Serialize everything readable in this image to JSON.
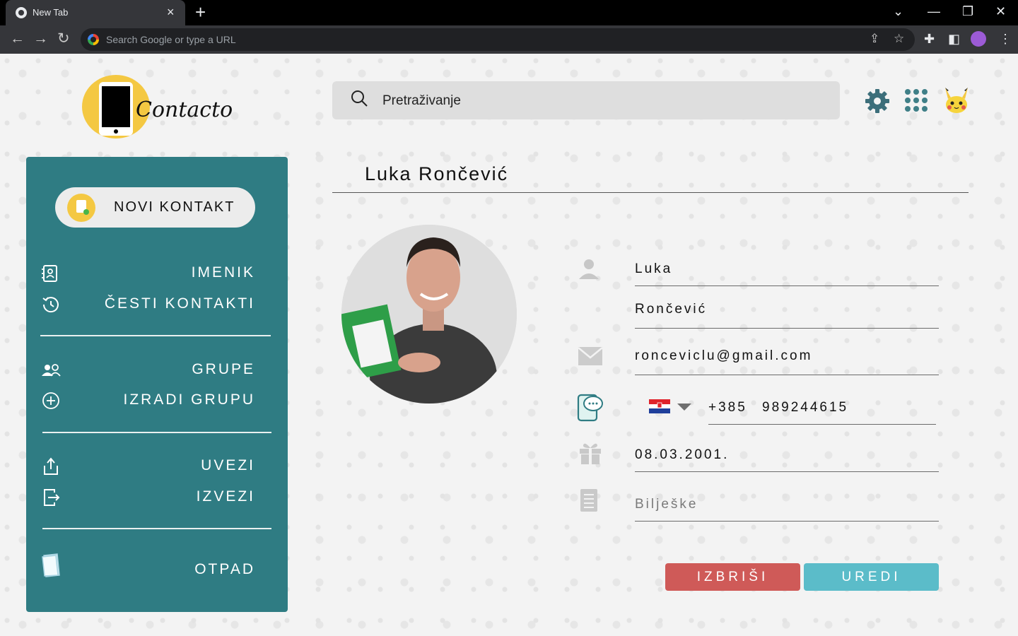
{
  "browser": {
    "tab_title": "New Tab",
    "omnibox_placeholder": "Search Google or type a URL"
  },
  "app": {
    "logo_text": "Contacto",
    "search_placeholder": "Pretraživanje"
  },
  "sidebar": {
    "new_contact": "NOVI KONTAKT",
    "items": {
      "imenik": "IMENIK",
      "cesti": "ČESTI KONTAKTI",
      "grupe": "GRUPE",
      "izradi": "IZRADI GRUPU",
      "uvezi": "UVEZI",
      "izvezi": "IZVEZI",
      "otpad": "OTPAD"
    }
  },
  "contact": {
    "name": "Luka Rončević",
    "first_name": "Luka",
    "last_name": "Rončević",
    "email": "ronceviclu@gmail.com",
    "phone_prefix": "+385",
    "phone_number": "989244615",
    "birthday": "08.03.2001.",
    "notes_placeholder": "Bilješke"
  },
  "actions": {
    "delete": "IZBRIŠI",
    "edit": "UREDI"
  },
  "colors": {
    "sidebar": "#2f7c83",
    "accent_yellow": "#f4c842",
    "delete": "#cf5a58",
    "edit": "#5bbcc9"
  }
}
